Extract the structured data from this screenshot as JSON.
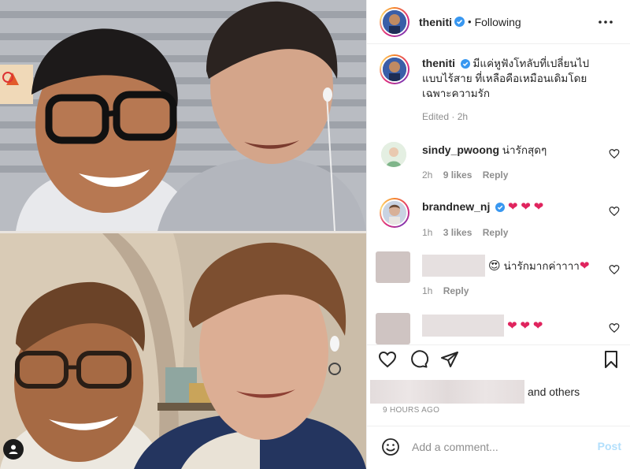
{
  "header": {
    "username": "theniti",
    "separator": "•",
    "follow_status": "Following"
  },
  "caption": {
    "username": "theniti",
    "text": "มีแค่หูฟังโทลับที่เปลี่ยนไปแบบไร้สาย ที่เหลือคือเหมือนเดิมโดยเฉพาะความรัก",
    "meta": "Edited · 2h"
  },
  "comments": [
    {
      "username": "sindy_pwoong",
      "text": "น่ารักสุดๆ",
      "time": "2h",
      "likes": "9 likes",
      "reply": "Reply"
    },
    {
      "username": "brandnew_nj",
      "text": "",
      "hearts": [
        "❤",
        "❤",
        "❤"
      ],
      "time": "1h",
      "likes": "3 likes",
      "reply": "Reply"
    },
    {
      "username": "",
      "text": "น่ารักมากค่าาาา",
      "emoji": "😍",
      "end_heart": "❤",
      "time": "1h",
      "reply": "Reply"
    },
    {
      "username": "",
      "hearts": [
        "❤",
        "❤",
        "❤"
      ]
    }
  ],
  "likes": {
    "suffix": "and others"
  },
  "timestamp": "9 HOURS AGO",
  "comment_box": {
    "placeholder": "Add a comment...",
    "post_label": "Post"
  },
  "icons": {
    "more": "more-horizontal-icon",
    "like": "heart-icon",
    "comment": "comment-bubble-icon",
    "share": "paper-plane-icon",
    "save": "bookmark-icon",
    "emoji": "smiley-icon",
    "tag": "user-tag-icon",
    "verified": "verified-badge-icon"
  },
  "colors": {
    "verified": "#3897f0",
    "heart": "#e0245e",
    "post_disabled": "#b2dffc",
    "muted": "#8e8e8e"
  }
}
